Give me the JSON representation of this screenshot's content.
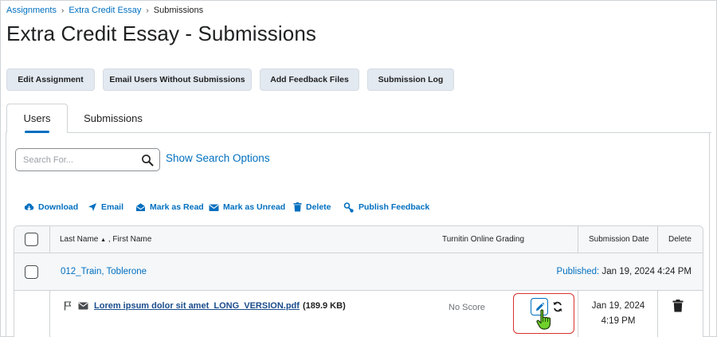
{
  "breadcrumb": {
    "items": [
      "Assignments",
      "Extra Credit Essay"
    ],
    "current": "Submissions"
  },
  "page_title": "Extra Credit Essay - Submissions",
  "actions": {
    "edit_assignment": "Edit Assignment",
    "email_users": "Email Users Without Submissions",
    "add_feedback": "Add Feedback Files",
    "submission_log": "Submission Log"
  },
  "tabs": {
    "users": "Users",
    "submissions": "Submissions"
  },
  "search": {
    "placeholder": "Search For...",
    "value": "",
    "options_link": "Show Search Options"
  },
  "toolbar": {
    "download": "Download",
    "email": "Email",
    "mark_read": "Mark as Read",
    "mark_unread": "Mark as Unread",
    "delete": "Delete",
    "publish_feedback": "Publish Feedback"
  },
  "table": {
    "headers": {
      "last_name": "Last Name",
      "first_name": ", First Name",
      "turnitin": "Turnitin Online Grading",
      "submission_date": "Submission Date",
      "delete": "Delete"
    },
    "rows": [
      {
        "user": "012_Train, Toblerone",
        "published_label": "Published:",
        "published_date": "Jan 19, 2024 4:24 PM",
        "submissions": [
          {
            "file_name": "Lorem ipsum dolor sit amet_LONG_VERSION.pdf",
            "file_size": "(189.9 KB)",
            "score": "No Score",
            "date_line1": "Jan 19, 2024",
            "date_line2": "4:19 PM"
          }
        ]
      }
    ]
  },
  "colors": {
    "link": "#006fbf",
    "button_bg": "#e3e9f1",
    "highlight": "#d9312b",
    "cursor": "#6fd12a"
  }
}
